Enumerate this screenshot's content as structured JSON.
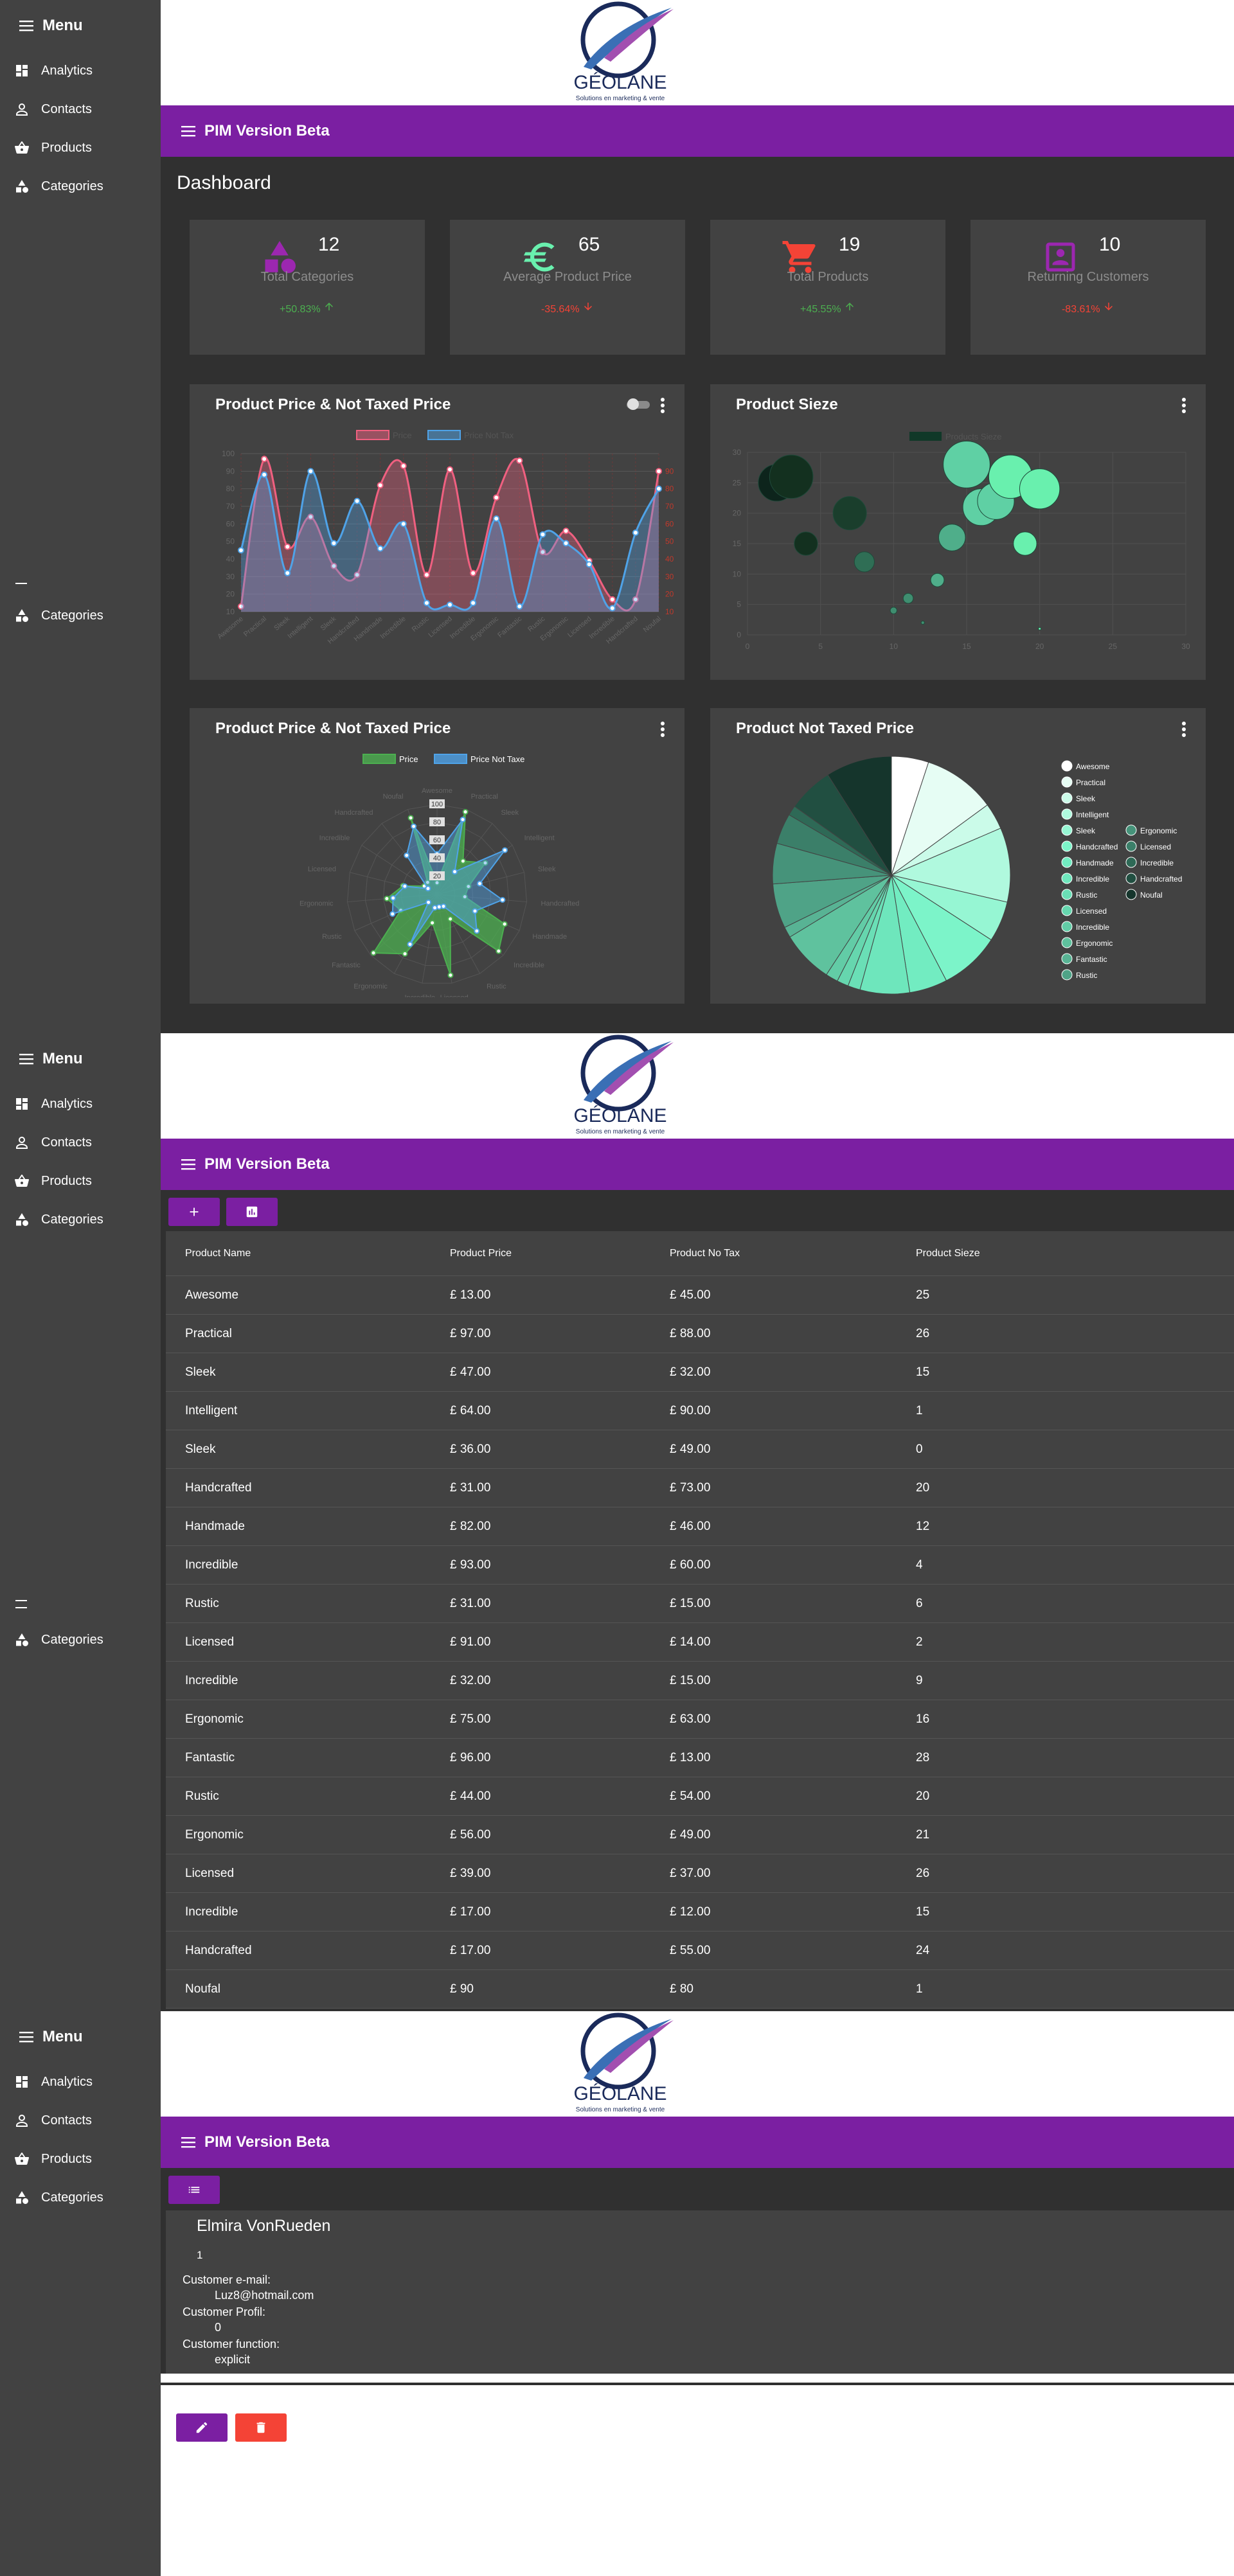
{
  "sidebar": {
    "title": "Menu",
    "items": [
      {
        "label": "Analytics",
        "icon": "dashboard-icon"
      },
      {
        "label": "Contacts",
        "icon": "person-icon"
      },
      {
        "label": "Products",
        "icon": "basket-icon"
      },
      {
        "label": "Categories",
        "icon": "category-icon"
      }
    ],
    "lower_item": "Categories"
  },
  "brand": {
    "name": "GÉOLANE",
    "tagline": "Solutions en marketing & vente"
  },
  "appbar": {
    "title": "PIM Version Beta"
  },
  "dashboard": {
    "title": "Dashboard",
    "stats": [
      {
        "value": "12",
        "label": "Total Categories",
        "change": "+50.83%",
        "direction": "up",
        "icon": "category-icon",
        "color": "#9c27b0"
      },
      {
        "value": "65",
        "label": "Average Product Price",
        "change": "-35.64%",
        "direction": "down",
        "icon": "euro-icon",
        "color": "#69f0ae"
      },
      {
        "value": "19",
        "label": "Total Products",
        "change": "+45.55%",
        "direction": "up",
        "icon": "cart-icon",
        "color": "#f44336"
      },
      {
        "value": "10",
        "label": "Returning Customers",
        "change": "-83.61%",
        "direction": "down",
        "icon": "portrait-icon",
        "color": "#9c27b0"
      }
    ],
    "cards": {
      "line_title": "Product Price & Not Taxed Price",
      "bubble_title": "Product Sieze",
      "radar_title": "Product Price & Not Taxed Price",
      "pie_title": "Product Not Taxed Price"
    }
  },
  "chart_data": [
    {
      "type": "line",
      "title": "Product Price & Not Taxed Price",
      "categories": [
        "Awesome",
        "Practical",
        "Sleek",
        "Intelligent",
        "Sleek",
        "Handcrafted",
        "Handmade",
        "Incredible",
        "Rustic",
        "Licensed",
        "Incredible",
        "Ergonomic",
        "Fantastic",
        "Rustic",
        "Ergonomic",
        "Licensed",
        "Incredible",
        "Handcrafted",
        "Noufal"
      ],
      "series": [
        {
          "name": "Price",
          "values": [
            13,
            97,
            47,
            64,
            36,
            31,
            82,
            93,
            31,
            91,
            32,
            75,
            96,
            44,
            56,
            39,
            17,
            17,
            90
          ],
          "color": "#f06080"
        },
        {
          "name": "Price Not Tax",
          "values": [
            45,
            88,
            32,
            90,
            49,
            73,
            46,
            60,
            15,
            14,
            15,
            63,
            13,
            54,
            49,
            37,
            12,
            55,
            80
          ],
          "color": "#4fa3e8"
        }
      ],
      "ylim": [
        10,
        100
      ],
      "y_ticks_left": [
        10,
        20,
        30,
        40,
        50,
        60,
        70,
        80,
        90,
        100
      ],
      "y_ticks_right": [
        10,
        20,
        30,
        40,
        50,
        60,
        70,
        80,
        90
      ],
      "grid": true,
      "legend": "top"
    },
    {
      "type": "scatter",
      "title": "Product Sieze",
      "legend_label": "Products Sieze",
      "points": [
        {
          "x": 2,
          "y": 25,
          "r": 11
        },
        {
          "x": 3,
          "y": 26,
          "r": 13
        },
        {
          "x": 4,
          "y": 15,
          "r": 7
        },
        {
          "x": 7,
          "y": 20,
          "r": 10
        },
        {
          "x": 8,
          "y": 12,
          "r": 6
        },
        {
          "x": 11,
          "y": 6,
          "r": 3
        },
        {
          "x": 12,
          "y": 2,
          "r": 1
        },
        {
          "x": 13,
          "y": 9,
          "r": 4
        },
        {
          "x": 14,
          "y": 16,
          "r": 8
        },
        {
          "x": 15,
          "y": 28,
          "r": 14
        },
        {
          "x": 16,
          "y": 21,
          "r": 11
        },
        {
          "x": 17,
          "y": 22,
          "r": 11
        },
        {
          "x": 18,
          "y": 26,
          "r": 13
        },
        {
          "x": 19,
          "y": 15,
          "r": 7
        },
        {
          "x": 20,
          "y": 24,
          "r": 12
        },
        {
          "x": 10,
          "y": 4,
          "r": 2
        },
        {
          "x": 20,
          "y": 1,
          "r": 0.5
        }
      ],
      "xlim": [
        0,
        30
      ],
      "ylim": [
        0,
        30
      ],
      "x_ticks": [
        0,
        5,
        10,
        15,
        20,
        25,
        30
      ],
      "y_ticks": [
        0,
        5,
        10,
        15,
        20,
        25,
        30
      ],
      "grid": true
    },
    {
      "type": "radar",
      "title": "Product Price & Not Taxed Price",
      "categories": [
        "Awesome",
        "Practical",
        "Sleek",
        "Intelligent",
        "Sleek",
        "Handcrafted",
        "Handmade",
        "Incredible",
        "Rustic",
        "Licensed",
        "Incredible",
        "Ergonomic",
        "Fantastic",
        "Rustic",
        "Ergonomic",
        "Licensed",
        "Incredible",
        "Handcrafted",
        "Noufal"
      ],
      "series": [
        {
          "name": "Price",
          "values": [
            13,
            97,
            47,
            64,
            36,
            31,
            82,
            93,
            31,
            91,
            32,
            75,
            96,
            44,
            56,
            39,
            17,
            17,
            90
          ],
          "color": "#4caf50"
        },
        {
          "name": "Price Not Taxe",
          "values": [
            45,
            88,
            32,
            90,
            49,
            73,
            46,
            60,
            15,
            14,
            15,
            63,
            13,
            54,
            49,
            37,
            12,
            55,
            80
          ],
          "color": "#4fa3e8"
        }
      ],
      "r_ticks": [
        20,
        40,
        60,
        80,
        100
      ],
      "legend": "top"
    },
    {
      "type": "pie",
      "title": "Product Not Taxed Price",
      "labels": [
        "Awesome",
        "Practical",
        "Sleek",
        "Intelligent",
        "Sleek",
        "Handcrafted",
        "Handmade",
        "Incredible",
        "Rustic",
        "Licensed",
        "Incredible",
        "Ergonomic",
        "Fantastic",
        "Rustic",
        "Ergonomic",
        "Licensed",
        "Incredible",
        "Handcrafted",
        "Noufal"
      ],
      "values": [
        45,
        88,
        32,
        90,
        49,
        73,
        46,
        60,
        15,
        14,
        15,
        63,
        13,
        54,
        49,
        37,
        12,
        55,
        80
      ],
      "legend": "right"
    }
  ],
  "products": {
    "columns": [
      "Product Name",
      "Product Price",
      "Product No Tax",
      "Product Sieze"
    ],
    "rows": [
      [
        "Awesome",
        "£ 13.00",
        "£ 45.00",
        "25"
      ],
      [
        "Practical",
        "£ 97.00",
        "£ 88.00",
        "26"
      ],
      [
        "Sleek",
        "£ 47.00",
        "£ 32.00",
        "15"
      ],
      [
        "Intelligent",
        "£ 64.00",
        "£ 90.00",
        "1"
      ],
      [
        "Sleek",
        "£ 36.00",
        "£ 49.00",
        "0"
      ],
      [
        "Handcrafted",
        "£ 31.00",
        "£ 73.00",
        "20"
      ],
      [
        "Handmade",
        "£ 82.00",
        "£ 46.00",
        "12"
      ],
      [
        "Incredible",
        "£ 93.00",
        "£ 60.00",
        "4"
      ],
      [
        "Rustic",
        "£ 31.00",
        "£ 15.00",
        "6"
      ],
      [
        "Licensed",
        "£ 91.00",
        "£ 14.00",
        "2"
      ],
      [
        "Incredible",
        "£ 32.00",
        "£ 15.00",
        "9"
      ],
      [
        "Ergonomic",
        "£ 75.00",
        "£ 63.00",
        "16"
      ],
      [
        "Fantastic",
        "£ 96.00",
        "£ 13.00",
        "28"
      ],
      [
        "Rustic",
        "£ 44.00",
        "£ 54.00",
        "20"
      ],
      [
        "Ergonomic",
        "£ 56.00",
        "£ 49.00",
        "21"
      ],
      [
        "Licensed",
        "£ 39.00",
        "£ 37.00",
        "26"
      ],
      [
        "Incredible",
        "£ 17.00",
        "£ 12.00",
        "15"
      ],
      [
        "Handcrafted",
        "£ 17.00",
        "£ 55.00",
        "24"
      ],
      [
        "Noufal",
        "£ 90",
        "£ 80",
        "1"
      ]
    ]
  },
  "customer": {
    "name": "Elmira VonRueden",
    "id": "1",
    "email_label": "Customer e-mail:",
    "email": "Luz8@hotmail.com",
    "profil_label": "Customer Profil:",
    "profil": "0",
    "function_label": "Customer function:",
    "function": "explicit"
  },
  "colors": {
    "accent": "#7b1fa2",
    "danger": "#f44336",
    "sidebar": "#424242",
    "surface": "#303030",
    "card": "#424242"
  }
}
